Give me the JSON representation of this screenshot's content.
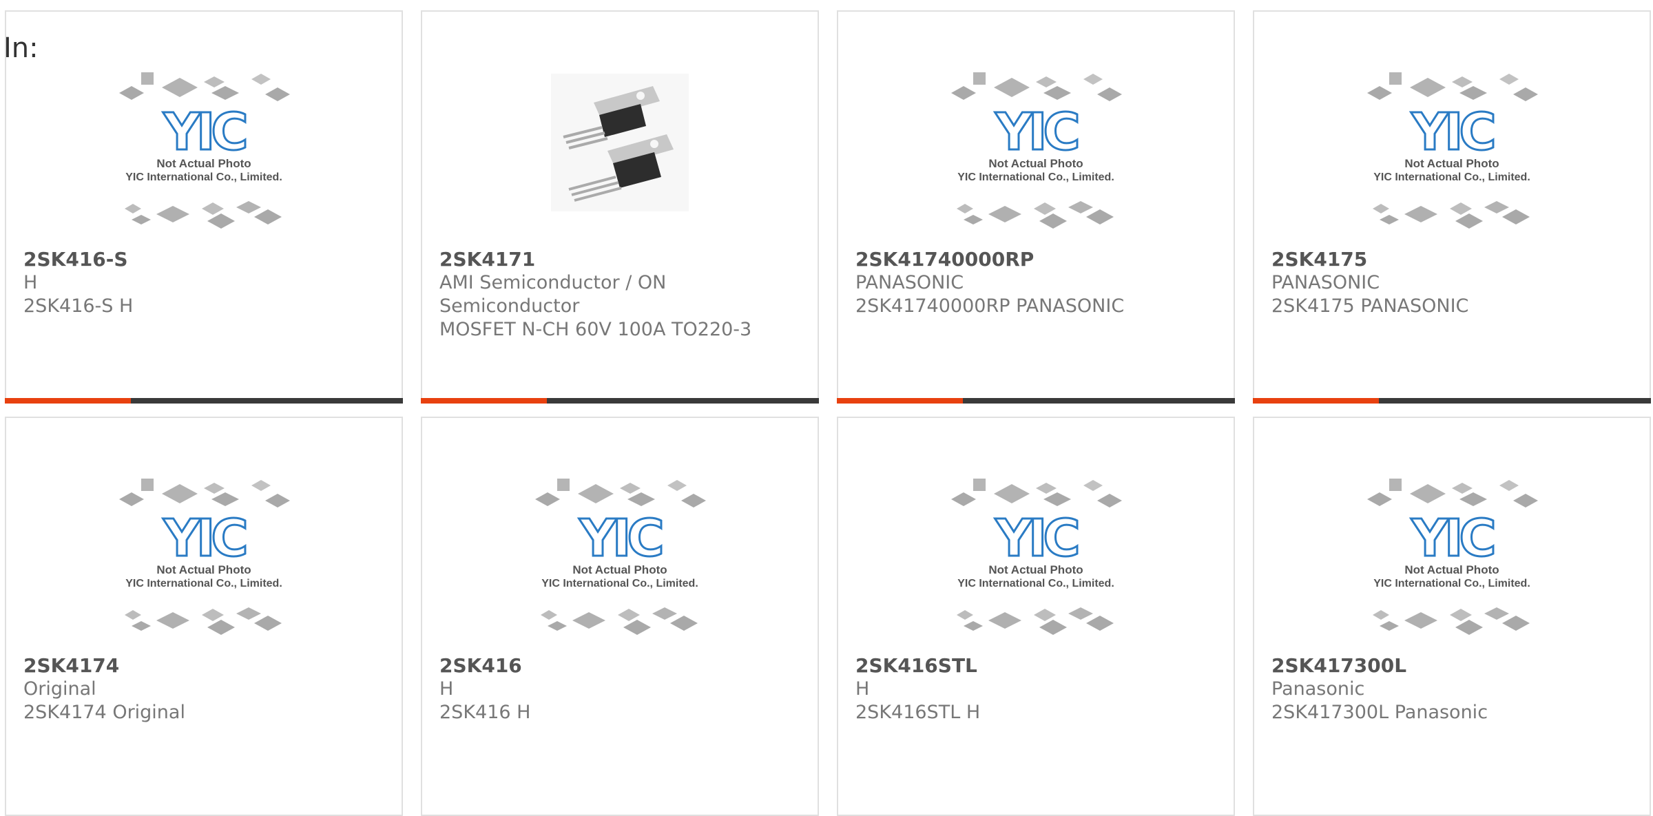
{
  "page": {
    "label": "In:"
  },
  "colors": {
    "accent": "#e8410f",
    "bar": "#3a3a3a",
    "logo": "#2a7bc4"
  },
  "placeholder": {
    "line1": "Not Actual Photo",
    "line2": "YIC International Co., Limited."
  },
  "products": [
    {
      "part": "2SK416-S",
      "line1": "H",
      "line2": "2SK416-S H",
      "line3": "",
      "image": "placeholder"
    },
    {
      "part": "2SK4171",
      "line1": "AMI Semiconductor / ON",
      "line2": "Semiconductor",
      "line3": "MOSFET N-CH 60V 100A TO220-3",
      "image": "to220-photo"
    },
    {
      "part": "2SK41740000RP",
      "line1": "PANASONIC",
      "line2": "2SK41740000RP PANASONIC",
      "line3": "",
      "image": "placeholder"
    },
    {
      "part": "2SK4175",
      "line1": "PANASONIC",
      "line2": "2SK4175 PANASONIC",
      "line3": "",
      "image": "placeholder"
    },
    {
      "part": "2SK4174",
      "line1": "Original",
      "line2": "2SK4174 Original",
      "line3": "",
      "image": "placeholder"
    },
    {
      "part": "2SK416",
      "line1": "H",
      "line2": "2SK416 H",
      "line3": "",
      "image": "placeholder"
    },
    {
      "part": "2SK416STL",
      "line1": "H",
      "line2": "2SK416STL H",
      "line3": "",
      "image": "placeholder"
    },
    {
      "part": "2SK417300L",
      "line1": "Panasonic",
      "line2": "2SK417300L Panasonic",
      "line3": "",
      "image": "placeholder"
    }
  ]
}
